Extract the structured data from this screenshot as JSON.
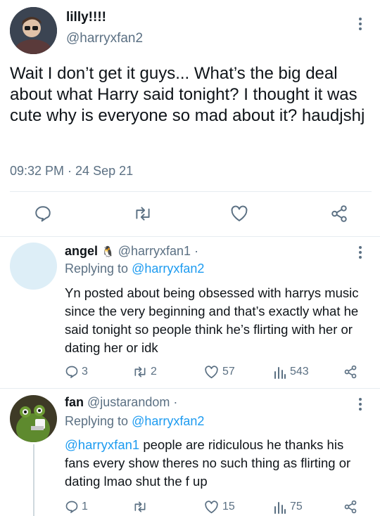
{
  "main_tweet": {
    "display_name": "lilly!!!!",
    "handle": "@harryxfan2",
    "text": "Wait I don’t get it guys... What’s the big deal about what Harry said tonight? I thought it was cute why is everyone so mad about it? haudjshj",
    "timestamp": "09:32 PM · 24 Sep 21"
  },
  "replies": [
    {
      "display_name": "angel",
      "emoji": "🐧",
      "handle": "@harryxfan1",
      "separator": "·",
      "replying_prefix": "Replying to",
      "replying_handle": "@harryxfan2",
      "text": "Yn posted about being obsessed with harrys music since the very beginning and that’s exactly what he said tonight so people think he’s flirting with her or dating her or idk",
      "replies_count": "3",
      "retweets_count": "2",
      "likes_count": "57",
      "views_count": "543"
    },
    {
      "display_name": "fan",
      "handle": "@justarandom",
      "separator": "·",
      "replying_prefix": "Replying to",
      "replying_handle": "@harryxfan2",
      "mention": "@harryxfan1",
      "text": " people are ridiculous he thanks his fans every show theres no such thing as flirting or dating lmao shut the f up",
      "replies_count": "1",
      "retweets_count": "",
      "likes_count": "15",
      "views_count": "75"
    }
  ],
  "colors": {
    "text": "#0f1419",
    "secondary": "#5b7083",
    "accent": "#1d9bf0",
    "divider": "#e6ecf0"
  },
  "icons": [
    "reply-icon",
    "retweet-icon",
    "like-icon",
    "share-icon",
    "views-icon",
    "more-icon"
  ]
}
